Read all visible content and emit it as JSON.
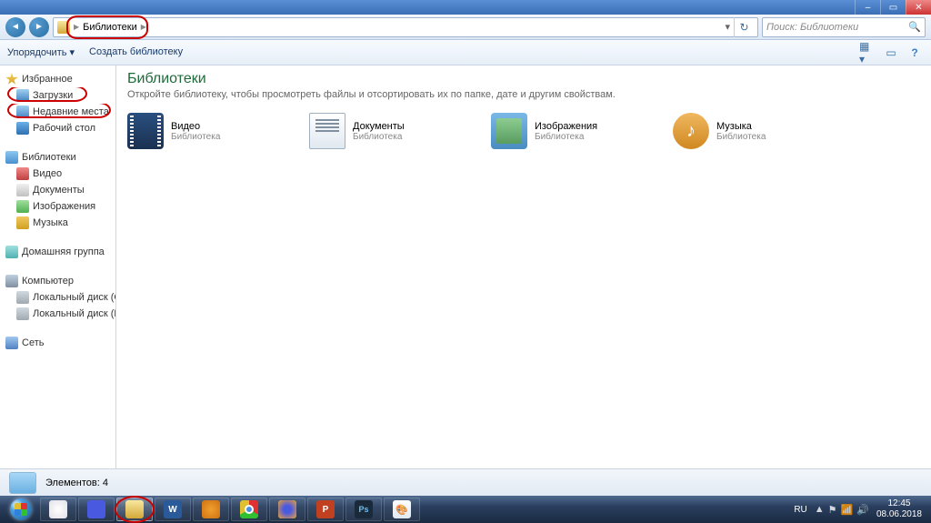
{
  "window": {
    "min": "–",
    "max": "▭",
    "close": "✕"
  },
  "breadcrumb": {
    "label": "Библиотеки",
    "arrow": "▶",
    "dropdown": "▾",
    "refresh": "↻"
  },
  "search": {
    "placeholder": "Поиск: Библиотеки"
  },
  "commandbar": {
    "organize": "Упорядочить ▾",
    "newlib": "Создать библиотеку",
    "help": "?"
  },
  "sidebar": {
    "favorites": "Избранное",
    "downloads": "Загрузки",
    "recent": "Недавние места",
    "desktop": "Рабочий стол",
    "libraries": "Библиотеки",
    "video": "Видео",
    "documents": "Документы",
    "images": "Изображения",
    "music": "Музыка",
    "homegroup": "Домашняя группа",
    "computer": "Компьютер",
    "driveC": "Локальный диск (C",
    "driveD": "Локальный диск (D",
    "network": "Сеть"
  },
  "main": {
    "title": "Библиотеки",
    "subtitle": "Откройте библиотеку, чтобы просмотреть файлы и отсортировать их по папке, дате и другим свойствам.",
    "type": "Библиотека",
    "items": [
      {
        "name": "Видео"
      },
      {
        "name": "Документы"
      },
      {
        "name": "Изображения"
      },
      {
        "name": "Музыка"
      }
    ]
  },
  "status": {
    "count": "Элементов: 4"
  },
  "taskbar": {
    "lang": "RU",
    "time": "12:45",
    "date": "08.06.2018",
    "word": "W",
    "pp": "P",
    "ps": "Ps",
    "tray_up": "▲"
  }
}
